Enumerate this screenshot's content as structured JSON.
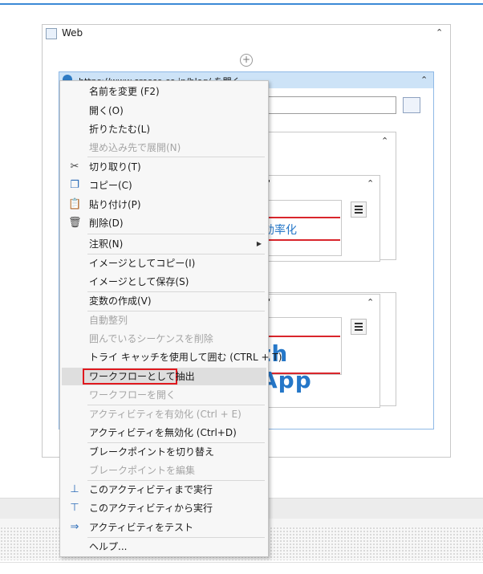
{
  "workflow": {
    "sequence_title": "Web",
    "browser_activity_title": "https://www.cresco.co.jp/blog/ を開く",
    "quote_mark_1": "..'",
    "quote_mark_2": "..'",
    "snippet_text_1": "効率化",
    "snippet_text_2": "th App"
  },
  "context_menu": {
    "items": [
      {
        "label": "名前を変更 (F2)",
        "enabled": true,
        "icon": ""
      },
      {
        "label": "開く(O)",
        "enabled": true,
        "icon": ""
      },
      {
        "label": "折りたたむ(L)",
        "enabled": true,
        "icon": ""
      },
      {
        "label": "埋め込み先で展開(N)",
        "enabled": false,
        "icon": ""
      },
      {
        "label": "切り取り(T)",
        "enabled": true,
        "icon": "scissors-icon"
      },
      {
        "label": "コピー(C)",
        "enabled": true,
        "icon": "copy-icon"
      },
      {
        "label": "貼り付け(P)",
        "enabled": true,
        "icon": "paste-icon"
      },
      {
        "label": "削除(D)",
        "enabled": true,
        "icon": "trash-icon"
      },
      {
        "label": "注釈(N)",
        "enabled": true,
        "icon": "",
        "submenu": true
      },
      {
        "label": "イメージとしてコピー(I)",
        "enabled": true,
        "icon": ""
      },
      {
        "label": "イメージとして保存(S)",
        "enabled": true,
        "icon": ""
      },
      {
        "label": "変数の作成(V)",
        "enabled": true,
        "icon": ""
      },
      {
        "label": "自動整列",
        "enabled": false,
        "icon": ""
      },
      {
        "label": "囲んでいるシーケンスを削除",
        "enabled": false,
        "icon": ""
      },
      {
        "label": "トライ キャッチを使用して囲む (CTRL + T)",
        "enabled": true,
        "icon": ""
      },
      {
        "label": "ワークフローとして抽出",
        "enabled": true,
        "icon": "",
        "highlighted": true
      },
      {
        "label": "ワークフローを開く",
        "enabled": false,
        "icon": ""
      },
      {
        "label": "アクティビティを有効化 (Ctrl + E)",
        "enabled": false,
        "icon": ""
      },
      {
        "label": "アクティビティを無効化 (Ctrl+D)",
        "enabled": true,
        "icon": ""
      },
      {
        "label": "ブレークポイントを切り替え",
        "enabled": true,
        "icon": ""
      },
      {
        "label": "ブレークポイントを編集",
        "enabled": false,
        "icon": ""
      },
      {
        "label": "このアクティビティまで実行",
        "enabled": true,
        "icon": "run-to-icon"
      },
      {
        "label": "このアクティビティから実行",
        "enabled": true,
        "icon": "run-from-icon"
      },
      {
        "label": "アクティビティをテスト",
        "enabled": true,
        "icon": "test-activity-icon"
      },
      {
        "label": "ヘルプ...",
        "enabled": true,
        "icon": ""
      }
    ]
  },
  "colors": {
    "accent": "#3c8ad6",
    "highlight_border": "#e0191f",
    "link_blue": "#2577c8"
  }
}
